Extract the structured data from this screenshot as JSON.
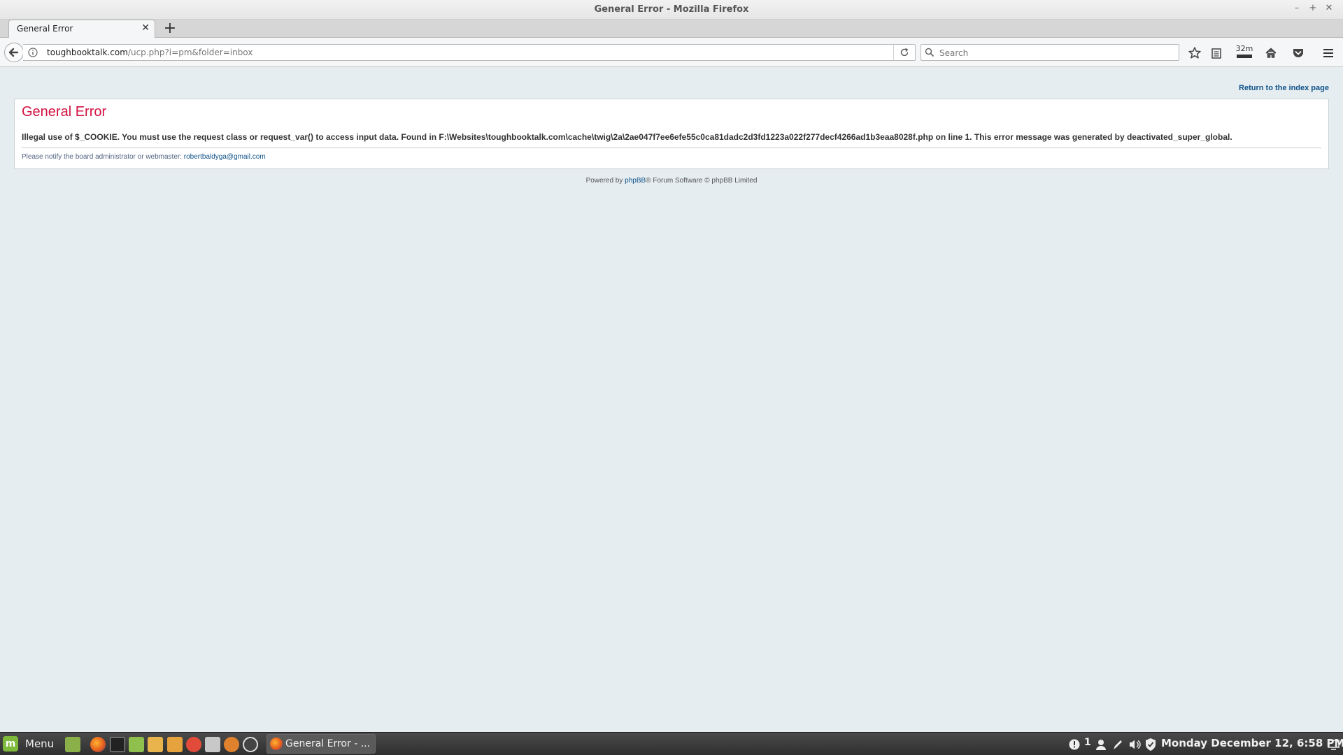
{
  "window": {
    "title": "General Error - Mozilla Firefox",
    "minimize": "–",
    "maximize": "+",
    "close": "✕"
  },
  "tabs": [
    {
      "label": "General Error",
      "close": "✕"
    }
  ],
  "new_tab": "+",
  "nav": {
    "url_domain": "toughbooktalk.com",
    "url_path": "/ucp.php?i=pm&folder=inbox",
    "search_placeholder": "Search",
    "timer_badge": "32m"
  },
  "page": {
    "return_link": "Return to the index page",
    "heading": "General Error",
    "message": "Illegal use of $_COOKIE. You must use the request class or request_var() to access input data. Found in F:\\Websites\\toughbooktalk.com\\cache\\twig\\2a\\2ae047f7ee6efe55c0ca81dadc2d3fd1223a022f277decf4266ad1b3eaa8028f.php on line 1. This error message was generated by deactivated_super_global.",
    "notify_text": "Please notify the board administrator or webmaster: ",
    "notify_email": "robertbaldyga@gmail.com",
    "footer_prefix": "Powered by ",
    "footer_link": "phpBB",
    "footer_suffix": "® Forum Software © phpBB Limited"
  },
  "taskbar": {
    "menu_label": "Menu",
    "task_label": "General Error - ...",
    "tray_count": "1",
    "clock": "Monday December 12,  6:58 PM"
  },
  "colors": {
    "heading": "#d31141",
    "link": "#105289",
    "page_bg": "#e5edf0"
  }
}
